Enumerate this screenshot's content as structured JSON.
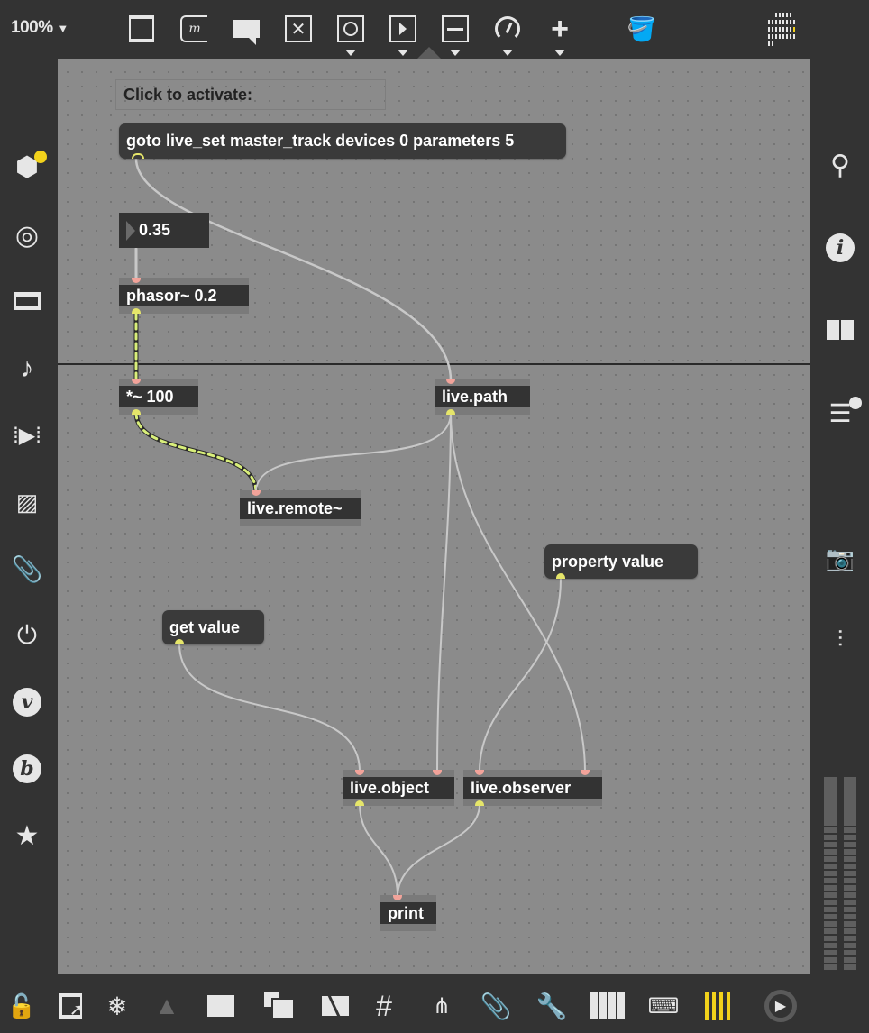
{
  "toolbar": {
    "zoom": "100%",
    "icons": [
      "presentation-panel-icon",
      "message-box-icon",
      "comment-icon",
      "toggle-icon",
      "button-icon",
      "number-box-icon",
      "slider-icon",
      "dial-icon",
      "add-object-icon",
      "paint-bucket-icon",
      "grid-dots-icon"
    ]
  },
  "patch": {
    "comment": "Click to activate:",
    "goto_message": "goto live_set master_track devices 0 parameters 5",
    "number_value": "0.35",
    "phasor": "phasor~ 0.2",
    "multiply": "*~ 100",
    "live_path": "live.path",
    "live_remote": "live.remote~",
    "property_value": "property value",
    "get_value": "get value",
    "live_object": "live.object",
    "live_observer": "live.observer",
    "print": "print"
  },
  "colors": {
    "signal_cord": "#d9ef7a",
    "message_cord": "#c8c8c8",
    "accent_yellow": "#f2d21b",
    "inlet": "#f2a39a",
    "outlet": "#e5e56a"
  },
  "left_sidebar": [
    "packages-icon",
    "target-icon",
    "device-icon",
    "music-note-icon",
    "media-icon",
    "image-icon",
    "paperclip-icon",
    "plug-icon",
    "v-icon",
    "b-icon",
    "star-icon"
  ],
  "right_sidebar": [
    "search-icon",
    "info-icon",
    "book-icon",
    "list-icon",
    "snapshot-icon",
    "mixer-icon"
  ],
  "bottom_toolbar": [
    "lock-icon",
    "presentation-icon",
    "freeze-icon",
    "warning-icon",
    "present-icon",
    "layers-icon",
    "hide-icon",
    "grid-icon",
    "hierarchy-icon",
    "attach-icon",
    "wrench-icon",
    "piano-icon",
    "keyboard-icon",
    "audio-bars-icon",
    "play-icon"
  ],
  "meters": {
    "left_level": 0,
    "right_level": 0
  }
}
